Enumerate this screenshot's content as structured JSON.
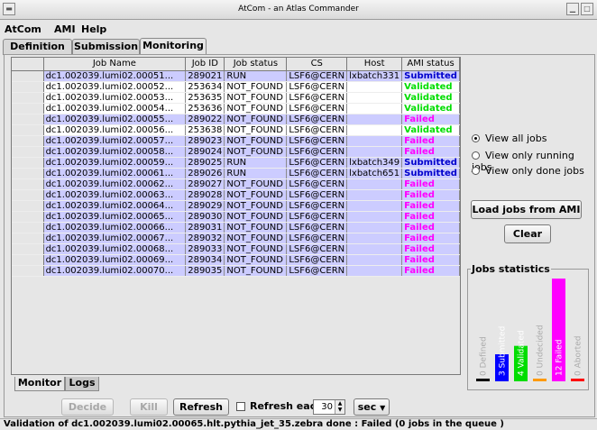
{
  "window": {
    "title": "AtCom - an Atlas Commander"
  },
  "menu": [
    {
      "label": "AtCom"
    },
    {
      "label": "AMI"
    },
    {
      "label": "Help"
    }
  ],
  "tabs": [
    {
      "label": "Definition",
      "active": false
    },
    {
      "label": "Submission",
      "active": false
    },
    {
      "label": "Monitoring",
      "active": true
    }
  ],
  "table": {
    "columns": [
      "",
      "Job Name",
      "Job ID",
      "Job status",
      "CS",
      "Host",
      "AMI status"
    ],
    "rows": [
      [
        "dc1.002039.lumi02.00051...",
        "289021",
        "RUN",
        "LSF6@CERN",
        "lxbatch331",
        "Submitted"
      ],
      [
        "dc1.002039.lumi02.00052...",
        "253634",
        "NOT_FOUND",
        "LSF6@CERN",
        "",
        "Validated"
      ],
      [
        "dc1.002039.lumi02.00053...",
        "253635",
        "NOT_FOUND",
        "LSF6@CERN",
        "",
        "Validated"
      ],
      [
        "dc1.002039.lumi02.00054...",
        "253636",
        "NOT_FOUND",
        "LSF6@CERN",
        "",
        "Validated"
      ],
      [
        "dc1.002039.lumi02.00055...",
        "289022",
        "NOT_FOUND",
        "LSF6@CERN",
        "",
        "Failed"
      ],
      [
        "dc1.002039.lumi02.00056...",
        "253638",
        "NOT_FOUND",
        "LSF6@CERN",
        "",
        "Validated"
      ],
      [
        "dc1.002039.lumi02.00057...",
        "289023",
        "NOT_FOUND",
        "LSF6@CERN",
        "",
        "Failed"
      ],
      [
        "dc1.002039.lumi02.00058...",
        "289024",
        "NOT_FOUND",
        "LSF6@CERN",
        "",
        "Failed"
      ],
      [
        "dc1.002039.lumi02.00059...",
        "289025",
        "RUN",
        "LSF6@CERN",
        "lxbatch349",
        "Submitted"
      ],
      [
        "dc1.002039.lumi02.00061...",
        "289026",
        "RUN",
        "LSF6@CERN",
        "lxbatch651",
        "Submitted"
      ],
      [
        "dc1.002039.lumi02.00062...",
        "289027",
        "NOT_FOUND",
        "LSF6@CERN",
        "",
        "Failed"
      ],
      [
        "dc1.002039.lumi02.00063...",
        "289028",
        "NOT_FOUND",
        "LSF6@CERN",
        "",
        "Failed"
      ],
      [
        "dc1.002039.lumi02.00064...",
        "289029",
        "NOT_FOUND",
        "LSF6@CERN",
        "",
        "Failed"
      ],
      [
        "dc1.002039.lumi02.00065...",
        "289030",
        "NOT_FOUND",
        "LSF6@CERN",
        "",
        "Failed"
      ],
      [
        "dc1.002039.lumi02.00066...",
        "289031",
        "NOT_FOUND",
        "LSF6@CERN",
        "",
        "Failed"
      ],
      [
        "dc1.002039.lumi02.00067...",
        "289032",
        "NOT_FOUND",
        "LSF6@CERN",
        "",
        "Failed"
      ],
      [
        "dc1.002039.lumi02.00068...",
        "289033",
        "NOT_FOUND",
        "LSF6@CERN",
        "",
        "Failed"
      ],
      [
        "dc1.002039.lumi02.00069...",
        "289034",
        "NOT_FOUND",
        "LSF6@CERN",
        "",
        "Failed"
      ],
      [
        "dc1.002039.lumi02.00070...",
        "289035",
        "NOT_FOUND",
        "LSF6@CERN",
        "",
        "Failed"
      ]
    ]
  },
  "view_options": [
    {
      "label": "View all jobs",
      "selected": true
    },
    {
      "label": "View only running jobs",
      "selected": false
    },
    {
      "label": "View only done jobs",
      "selected": false
    }
  ],
  "buttons": {
    "load_jobs": "Load jobs from AMI",
    "clear": "Clear",
    "decide": "Decide",
    "kill": "Kill",
    "refresh": "Refresh"
  },
  "refresh": {
    "label": "Refresh each",
    "value": "30",
    "unit": "sec"
  },
  "stats": {
    "title": "Jobs statistics",
    "bars": [
      {
        "name": "Defined",
        "count": 0,
        "color": "#000000"
      },
      {
        "name": "Submitted",
        "count": 3,
        "color": "#0000ff"
      },
      {
        "name": "Validated",
        "count": 4,
        "color": "#00dd00"
      },
      {
        "name": "Undecided",
        "count": 0,
        "color": "#ff9900"
      },
      {
        "name": "Failed",
        "count": 12,
        "color": "#ff00ff"
      },
      {
        "name": "Aborted",
        "count": 0,
        "color": "#ff0000"
      }
    ]
  },
  "sub_tabs": [
    {
      "label": "Monitor",
      "active": true
    },
    {
      "label": "Logs",
      "active": false
    }
  ],
  "status_message": "Validation of dc1.002039.lumi02.00065.hlt.pythia_jet_35.zebra done : Failed (0 jobs in the queue )",
  "colors": {
    "row_highlight": "#ccccff",
    "row_plain": "#ffffff",
    "submitted": "#0000cc",
    "validated": "#00dd00",
    "failed": "#ff00ff"
  }
}
